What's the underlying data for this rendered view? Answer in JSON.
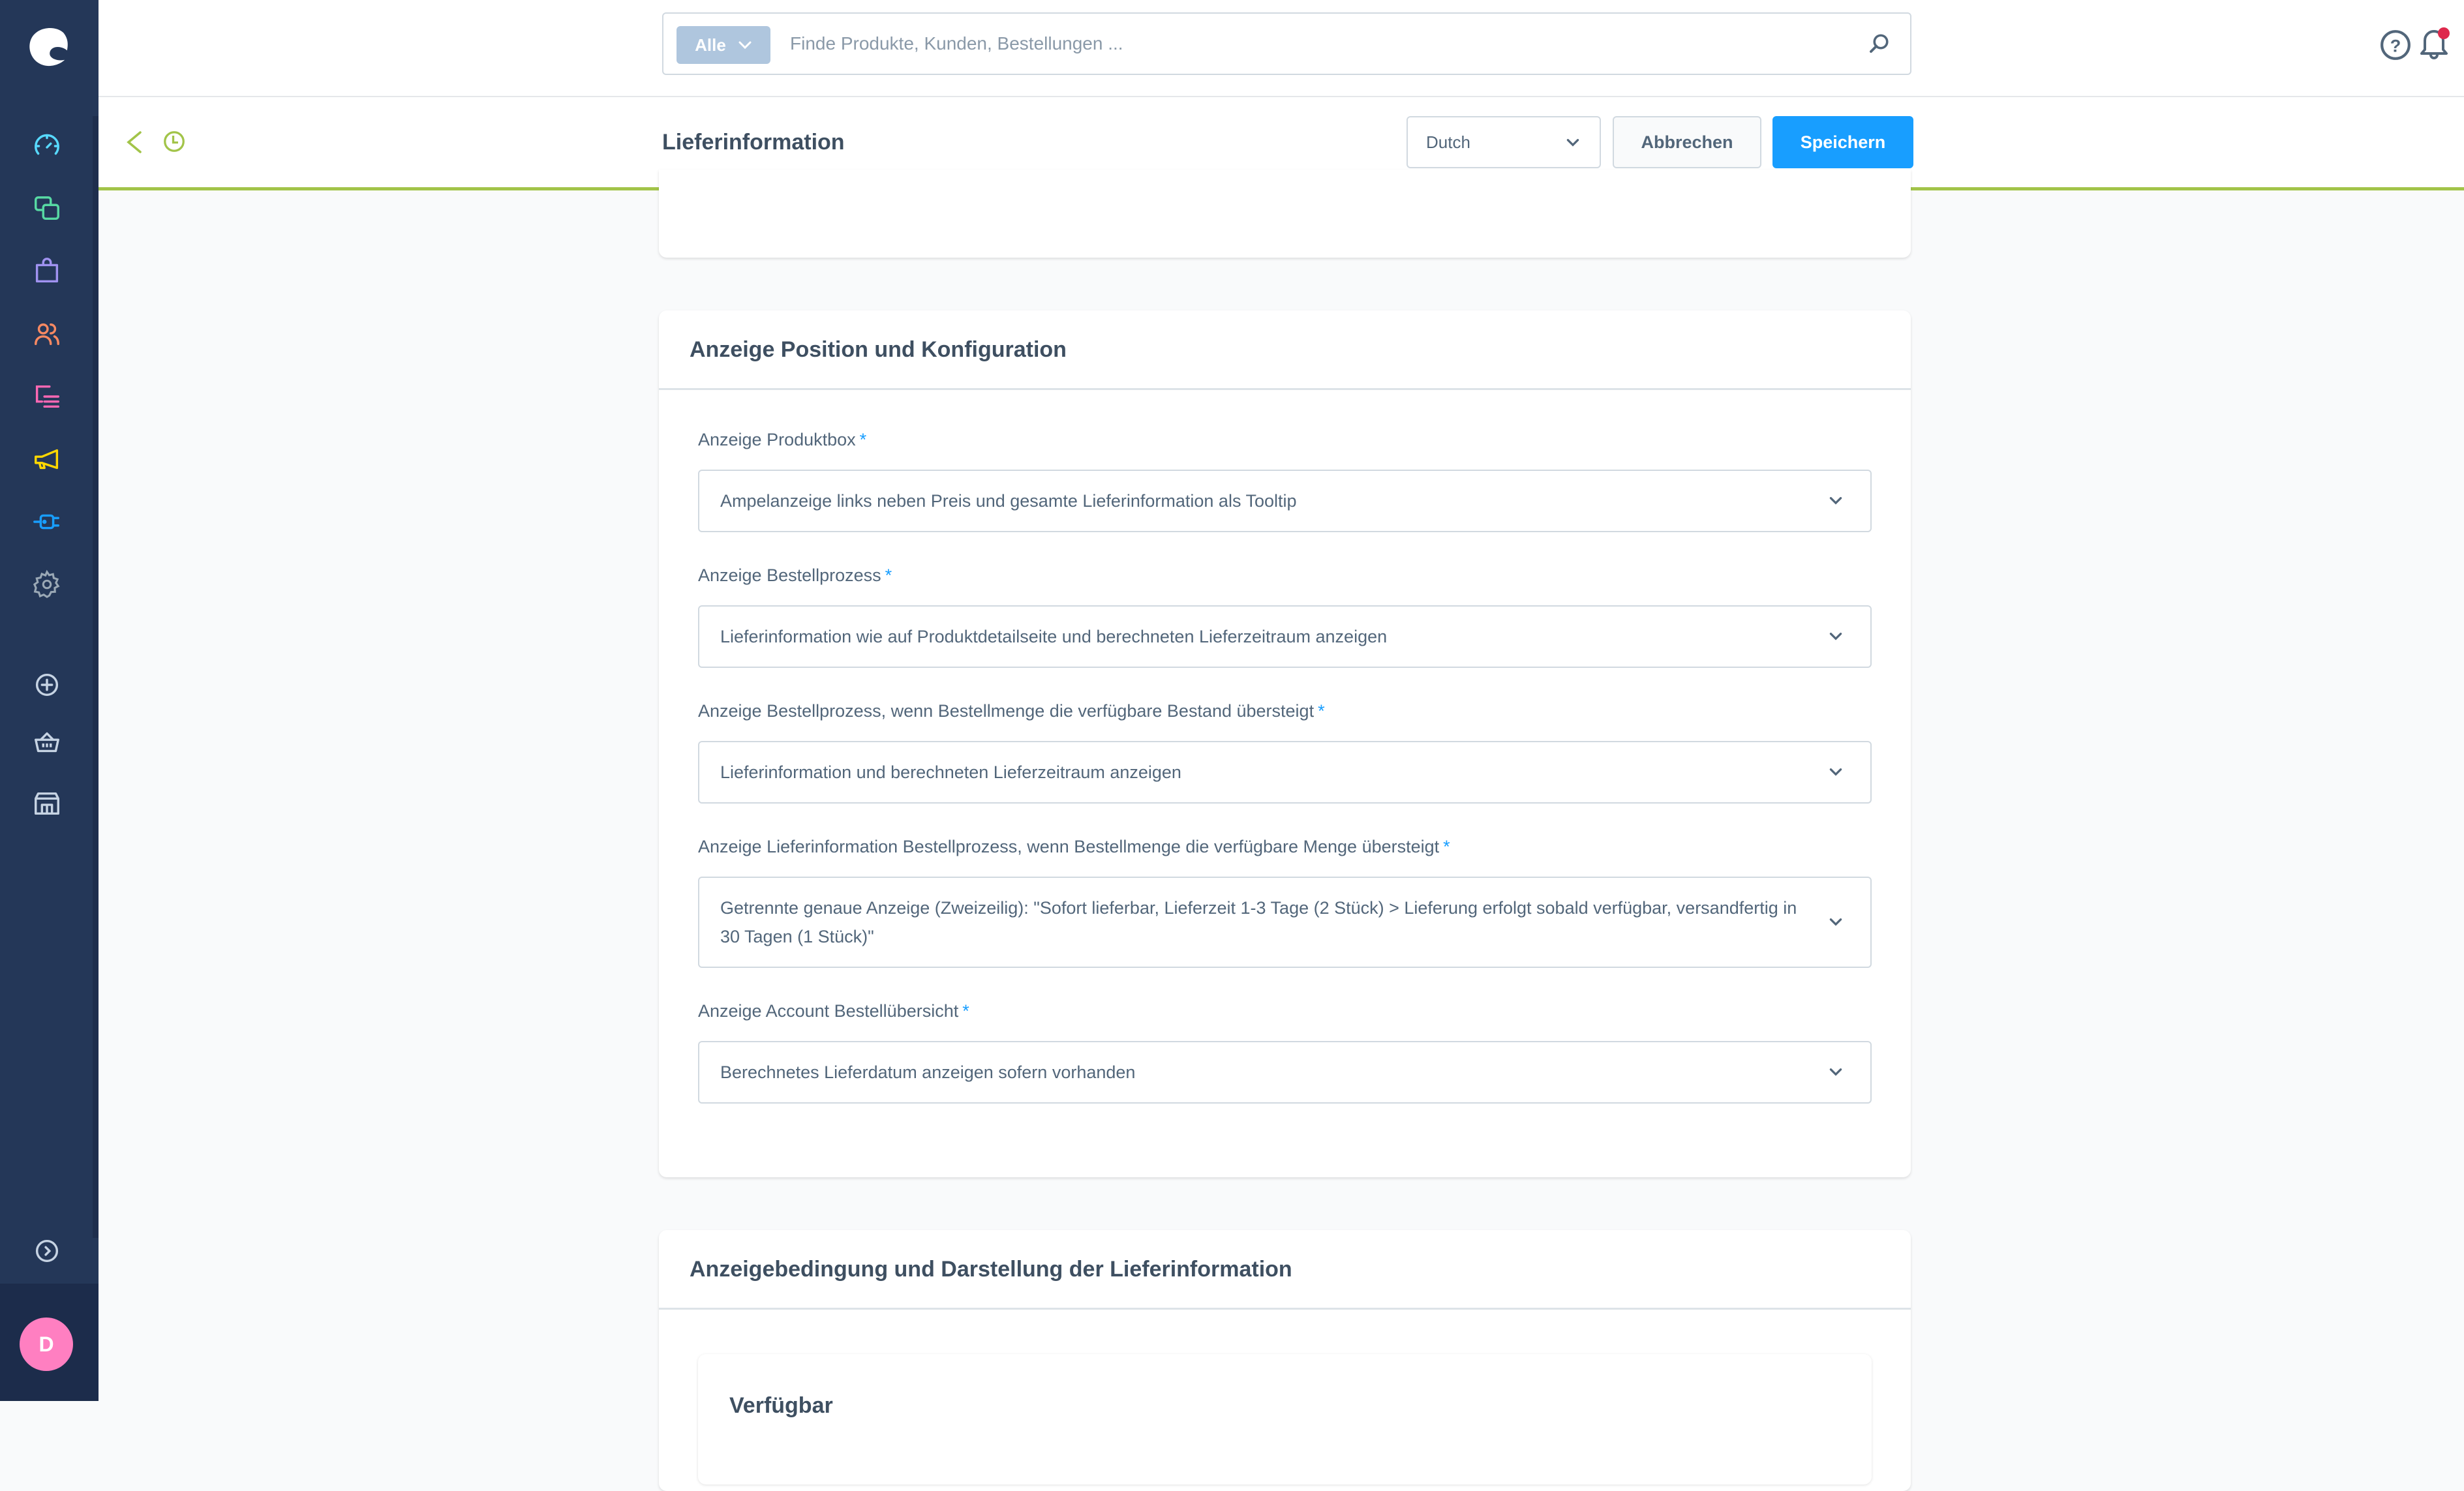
{
  "app": {
    "brand": "Shopware Administration",
    "avatar_initial": "D"
  },
  "sidebar": {
    "items": [
      {
        "name": "dashboard",
        "icon": "gauge-icon",
        "color": "#57d9ff"
      },
      {
        "name": "catalogues",
        "icon": "products-icon",
        "color": "#57d9a3"
      },
      {
        "name": "orders",
        "icon": "shopping-bag-icon",
        "color": "#a092f0"
      },
      {
        "name": "customers",
        "icon": "users-icon",
        "color": "#f88962"
      },
      {
        "name": "content",
        "icon": "content-icon",
        "color": "#ff68b4"
      },
      {
        "name": "marketing",
        "icon": "megaphone-icon",
        "color": "#ffd700"
      },
      {
        "name": "extensions",
        "icon": "plug-icon",
        "color": "#189eff"
      },
      {
        "name": "settings",
        "icon": "gear-icon",
        "color": "#9aa8b5"
      }
    ],
    "secondary": [
      {
        "name": "add",
        "icon": "plus-circle-icon"
      },
      {
        "name": "sales-channel-storefront",
        "icon": "basket-icon"
      },
      {
        "name": "sales-channel-headless",
        "icon": "storefront-icon"
      }
    ],
    "expand_icon": "chevron-circle-right-icon"
  },
  "topbar": {
    "search_type_label": "Alle",
    "search_placeholder": "Finde Produkte, Kunden, Bestellungen ...",
    "notification_badge_color": "#de294c"
  },
  "subheader": {
    "title": "Lieferinformation",
    "language": "Dutch",
    "cancel_label": "Abbrechen",
    "save_label": "Speichern",
    "accent_color": "#a2c449",
    "primary_color": "#189eff"
  },
  "cards": {
    "display": {
      "title": "Anzeige Position und Konfiguration",
      "fields": [
        {
          "label": "Anzeige Produktbox",
          "required": "*",
          "value": "Ampelanzeige links neben Preis und gesamte Lieferinformation als Tooltip"
        },
        {
          "label": "Anzeige Bestellprozess",
          "required": "*",
          "value": "Lieferinformation wie auf Produktdetailseite und berechneten Lieferzeitraum anzeigen"
        },
        {
          "label": "Anzeige Bestellprozess, wenn Bestellmenge die verfügbare Bestand übersteigt",
          "required": "*",
          "value": "Lieferinformation und berechneten Lieferzeitraum anzeigen"
        },
        {
          "label": "Anzeige Lieferinformation Bestellprozess, wenn Bestellmenge die verfügbare Menge übersteigt",
          "required": "*",
          "value": "Getrennte genaue Anzeige (Zweizeilig): \"Sofort lieferbar, Lieferzeit 1-3 Tage (2 Stück) > Lieferung erfolgt sobald verfügbar, versandfertig in 30 Tagen (1 Stück)\""
        },
        {
          "label": "Anzeige Account Bestellübersicht",
          "required": "*",
          "value": "Berechnetes Lieferdatum anzeigen sofern vorhanden"
        }
      ]
    },
    "conditions": {
      "title": "Anzeigebedingung und Darstellung der Lieferinformation",
      "subcard_title": "Verfügbar"
    }
  }
}
